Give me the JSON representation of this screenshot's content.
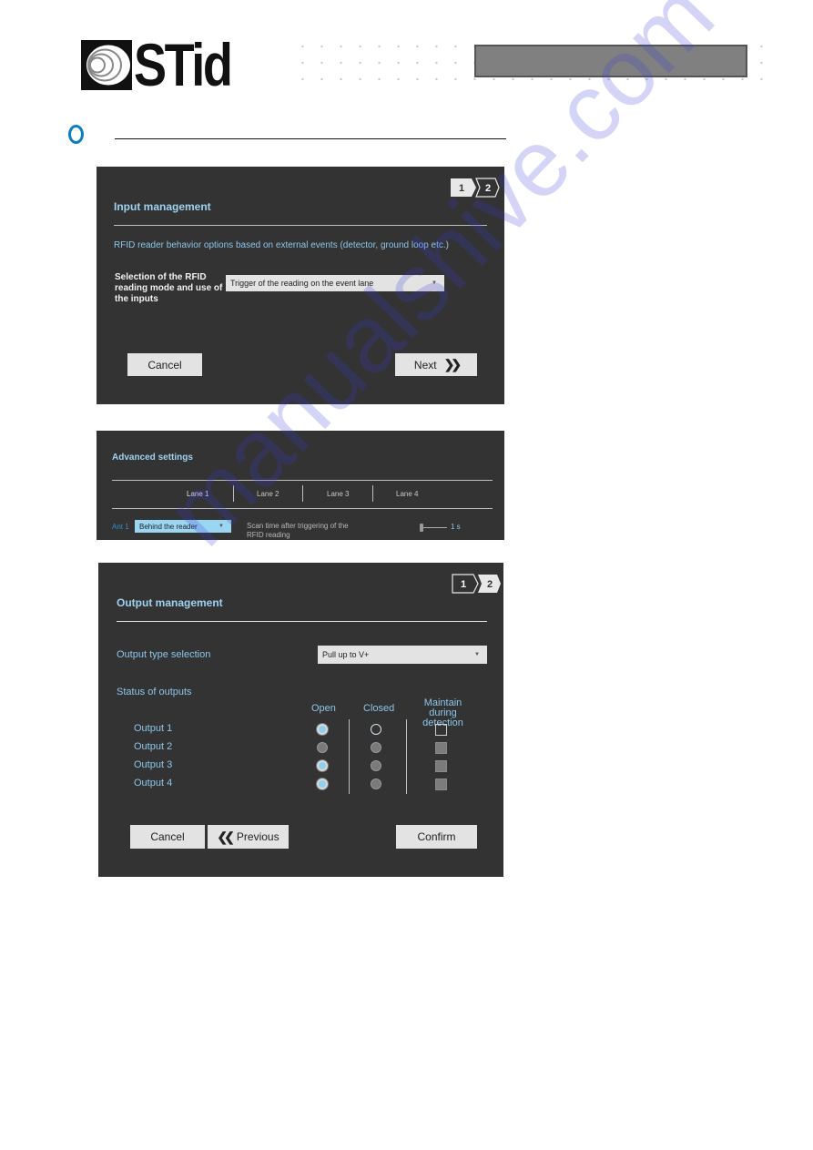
{
  "header": {
    "logo_text": "STid",
    "section_bullet_color": "#0b7dc0"
  },
  "input_panel": {
    "steps": [
      "1",
      "2"
    ],
    "active_step": 1,
    "title": "Input management",
    "description": "RFID reader behavior options based on external events (detector, ground loop etc.)",
    "mode_label_line1": "Selection of the RFID",
    "mode_label_line2": "reading mode and use of",
    "mode_label_line3": "the inputs",
    "mode_select_value": "Trigger of the reading on the event lane",
    "cancel_label": "Cancel",
    "next_label": "Next"
  },
  "advanced_panel": {
    "title": "Advanced settings",
    "lanes": [
      "Lane 1",
      "Lane 2",
      "Lane 3",
      "Lane 4"
    ],
    "active_lane": "Lane 1",
    "ant_label": "Ant 1",
    "ant_select_value": "Behind the reader",
    "scan_time_label_line1": "Scan time after triggering of the",
    "scan_time_label_line2": "RFID reading",
    "scan_time_value": "1 s",
    "scan_time_slider_fraction": 0.0
  },
  "output_panel": {
    "steps": [
      "1",
      "2"
    ],
    "active_step": 2,
    "title": "Output management",
    "type_label": "Output type selection",
    "type_select_value": "Pull up to V+",
    "status_label": "Status of outputs",
    "col_open": "Open",
    "col_closed": "Closed",
    "col_maintain_line1": "Maintain during",
    "col_maintain_line2": "detection",
    "outputs": [
      {
        "label": "Output 1",
        "state": "open",
        "maintain": false,
        "enabled": true
      },
      {
        "label": "Output 2",
        "state": "none",
        "maintain": false,
        "enabled": false
      },
      {
        "label": "Output 3",
        "state": "open",
        "maintain": false,
        "enabled": false
      },
      {
        "label": "Output 4",
        "state": "open",
        "maintain": false,
        "enabled": false
      }
    ],
    "cancel_label": "Cancel",
    "previous_label": "Previous",
    "confirm_label": "Confirm"
  },
  "watermark": "manualshive.com"
}
